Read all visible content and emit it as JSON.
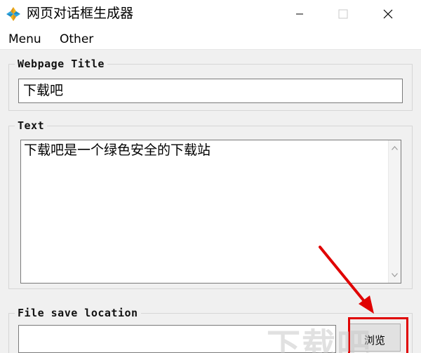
{
  "window": {
    "title": "网页对话框生成器",
    "icons": {
      "app": "app-logo-icon",
      "minimize": "minimize-icon",
      "maximize": "maximize-icon",
      "close": "close-icon"
    }
  },
  "menu": {
    "items": [
      {
        "label": "Menu"
      },
      {
        "label": "Other"
      }
    ]
  },
  "webpage_title": {
    "legend": "Webpage Title",
    "value": "下载吧"
  },
  "text": {
    "legend": "Text",
    "value": "下载吧是一个绿色安全的下载站"
  },
  "file_save": {
    "legend": "File save location",
    "value": "",
    "browse_label": "浏览"
  },
  "watermark": "下载吧",
  "colors": {
    "highlight": "#e00000",
    "arrow": "#e00000"
  }
}
